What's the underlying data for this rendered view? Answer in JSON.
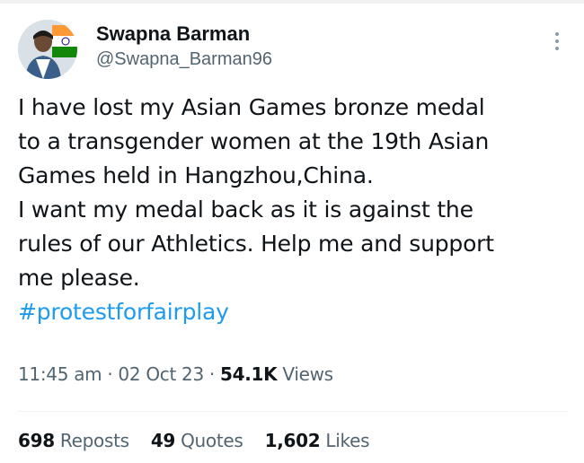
{
  "author": {
    "display_name": "Swapna Barman",
    "handle": "@Swapna_Barman96"
  },
  "tweet": {
    "lines": [
      "I have lost my Asian Games bronze medal",
      "to a transgender women at the 19th Asian",
      "Games held in Hangzhou,China.",
      "I want my medal back as it is against the",
      "rules of our Athletics. Help me and support",
      "me please."
    ],
    "hashtag": "#protestforfairplay"
  },
  "meta": {
    "time": "11:45 am",
    "date": "02 Oct 23",
    "views_count": "54.1K",
    "views_label": "Views",
    "separator": "·"
  },
  "stats": [
    {
      "count": "698",
      "label": "Reposts"
    },
    {
      "count": "49",
      "label": "Quotes"
    },
    {
      "count": "1,602",
      "label": "Likes"
    }
  ],
  "icons": {
    "more": "more-vertical-icon",
    "avatar": "avatar-with-flag"
  },
  "colors": {
    "text": "#0f1419",
    "secondary": "#536471",
    "link": "#1d9bf0",
    "divider": "#eff3f4"
  }
}
